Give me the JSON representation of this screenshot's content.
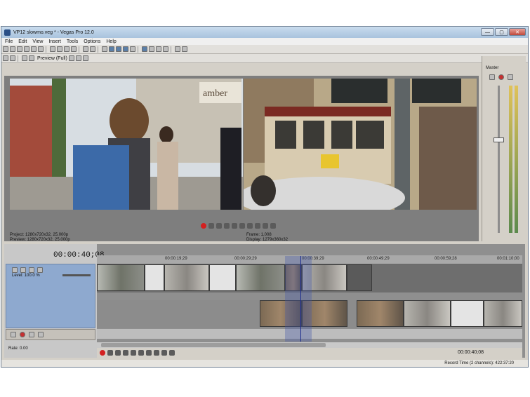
{
  "window": {
    "title": "VP12 slowmo.veg * - Vegas Pro 12.0",
    "btn_min": "—",
    "btn_max": "▢",
    "btn_close": "✕"
  },
  "menu": [
    "File",
    "Edit",
    "View",
    "Insert",
    "Tools",
    "Options",
    "Help"
  ],
  "preview": {
    "mode": "Preview (Full)",
    "sign_text": "amber",
    "project": "Project:  1280x720x32, 25.000p",
    "preview_info": "Preview:  1280x720x32, 25.000p",
    "frame": "Frame:      1,008",
    "display": "Display:    1279x360x32"
  },
  "mixer": {
    "label": "Master"
  },
  "timeline": {
    "timecode": "00:00:40;08",
    "ruler": [
      "00:00:19;29",
      "00:00:29;29",
      "00:00:39;29",
      "00:00:49;29",
      "00:00:59;28",
      "00:01:10;00"
    ],
    "track_level": "Level: 100.0 %",
    "rate": "Rate: 0.00",
    "transport_time": "00:00:40;08"
  },
  "status": {
    "record_time": "Record Time (2 channels): 422:37:20"
  },
  "icons": [
    "play-icon",
    "stop-icon",
    "pause-icon",
    "record-icon",
    "loop-icon",
    "rewind-icon",
    "fast-forward-icon"
  ]
}
